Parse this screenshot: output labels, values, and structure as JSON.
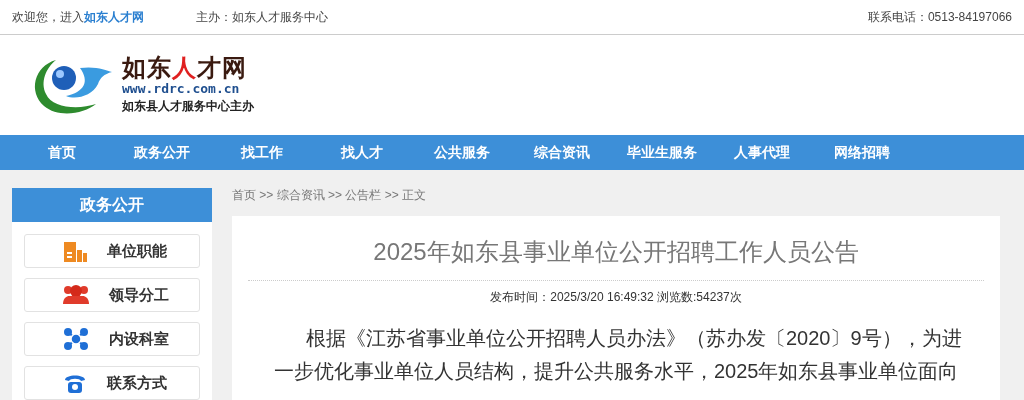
{
  "topbar": {
    "welcome": "欢迎您，进入",
    "site_link": "如东人才网",
    "host": "主办：如东人才服务中心",
    "phone": "联系电话：0513-84197066"
  },
  "logo": {
    "title_parts": [
      {
        "text": "如东",
        "color": "#3a1a10"
      },
      {
        "text": "人",
        "color": "#e02020"
      },
      {
        "text": "才网",
        "color": "#3a1a10"
      }
    ],
    "url": "www.rdrc.com.cn",
    "subtitle": "如东县人才服务中心主办"
  },
  "nav": [
    "首页",
    "政务公开",
    "找工作",
    "找人才",
    "公共服务",
    "综合资讯",
    "毕业生服务",
    "人事代理",
    "网络招聘"
  ],
  "sidebar": {
    "title": "政务公开",
    "items": [
      {
        "label": "单位职能",
        "kind": "building"
      },
      {
        "label": "领导分工",
        "kind": "people"
      },
      {
        "label": "内设科室",
        "kind": "network"
      },
      {
        "label": "联系方式",
        "kind": "phone"
      }
    ]
  },
  "breadcrumb": "首页 >> 综合资讯 >> 公告栏 >> 正文",
  "article": {
    "title": "2025年如东县事业单位公开招聘工作人员公告",
    "meta": "发布时间：2025/3/20 16:49:32 浏览数:54237次",
    "lines": [
      "根据《江苏省事业单位公开招聘人员办法》（苏办发〔2020〕9号），为进",
      "一步优化事业单位人员结构，提升公共服务水平，2025年如东县事业单位面向"
    ]
  }
}
